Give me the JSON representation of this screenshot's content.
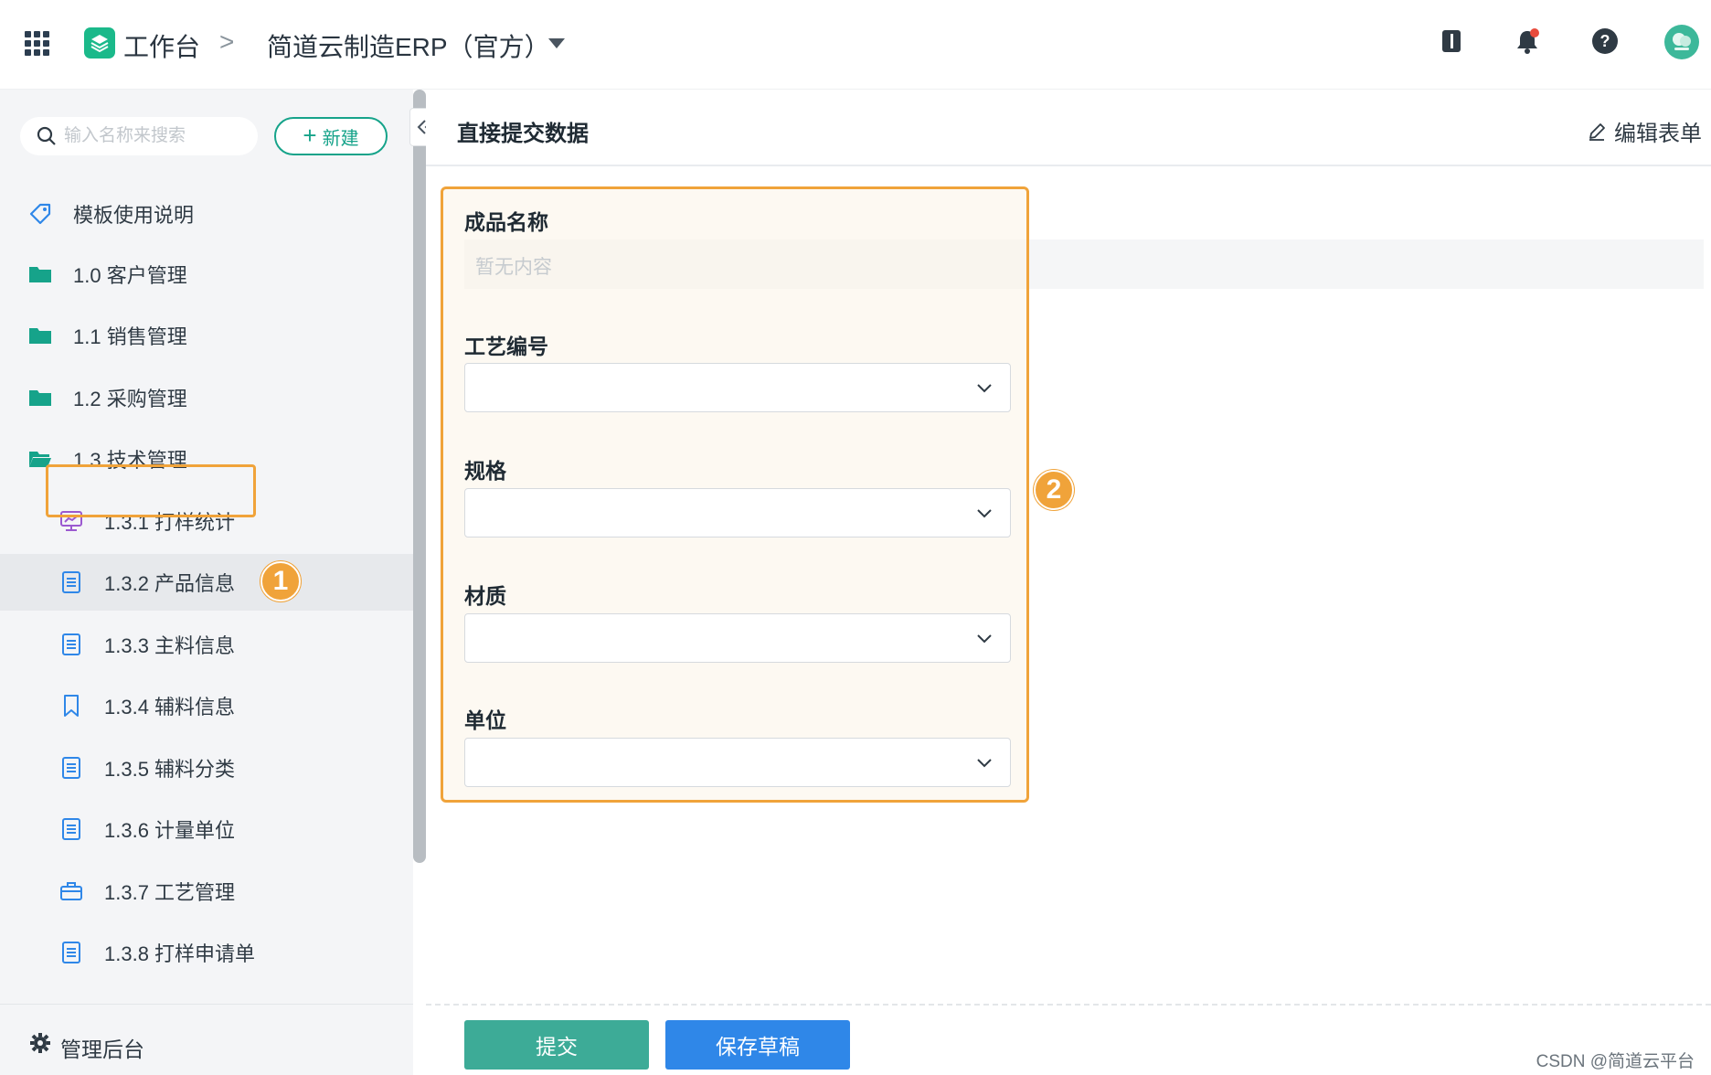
{
  "topbar": {
    "brand": "工作台",
    "separator": ">",
    "app_name": "简道云制造ERP（官方）"
  },
  "sidebar": {
    "search_placeholder": "输入名称来搜索",
    "new_label": "新建",
    "items": [
      {
        "label": "模板使用说明",
        "icon": "tag-icon"
      },
      {
        "label": "1.0 客户管理",
        "icon": "folder-icon"
      },
      {
        "label": "1.1 销售管理",
        "icon": "folder-icon"
      },
      {
        "label": "1.2 采购管理",
        "icon": "folder-icon"
      },
      {
        "label": "1.3 技术管理",
        "icon": "folder-open-icon"
      },
      {
        "label": "1.3.1 打样统计",
        "icon": "dashboard-icon"
      },
      {
        "label": "1.3.2 产品信息",
        "icon": "form-icon"
      },
      {
        "label": "1.3.3 主料信息",
        "icon": "form-icon"
      },
      {
        "label": "1.3.4 辅料信息",
        "icon": "bookmark-icon"
      },
      {
        "label": "1.3.5 辅料分类",
        "icon": "form-icon"
      },
      {
        "label": "1.3.6 计量单位",
        "icon": "form-icon"
      },
      {
        "label": "1.3.7 工艺管理",
        "icon": "briefcase-icon"
      },
      {
        "label": "1.3.8 打样申请单",
        "icon": "form-icon"
      }
    ],
    "admin_label": "管理后台"
  },
  "annotations": {
    "badge_1": "1",
    "badge_2": "2"
  },
  "main": {
    "title": "直接提交数据",
    "edit_label": "编辑表单",
    "fields": [
      {
        "label": "成品名称",
        "placeholder": "暂无内容"
      },
      {
        "label": "工艺编号"
      },
      {
        "label": "规格"
      },
      {
        "label": "材质"
      },
      {
        "label": "单位"
      }
    ],
    "submit_label": "提交",
    "draft_label": "保存草稿"
  },
  "watermark": "CSDN @简道云平台",
  "colors": {
    "accent": "#16a38a",
    "highlight": "#f0a33a",
    "submit": "#3dab97",
    "draft": "#2f87e8"
  }
}
